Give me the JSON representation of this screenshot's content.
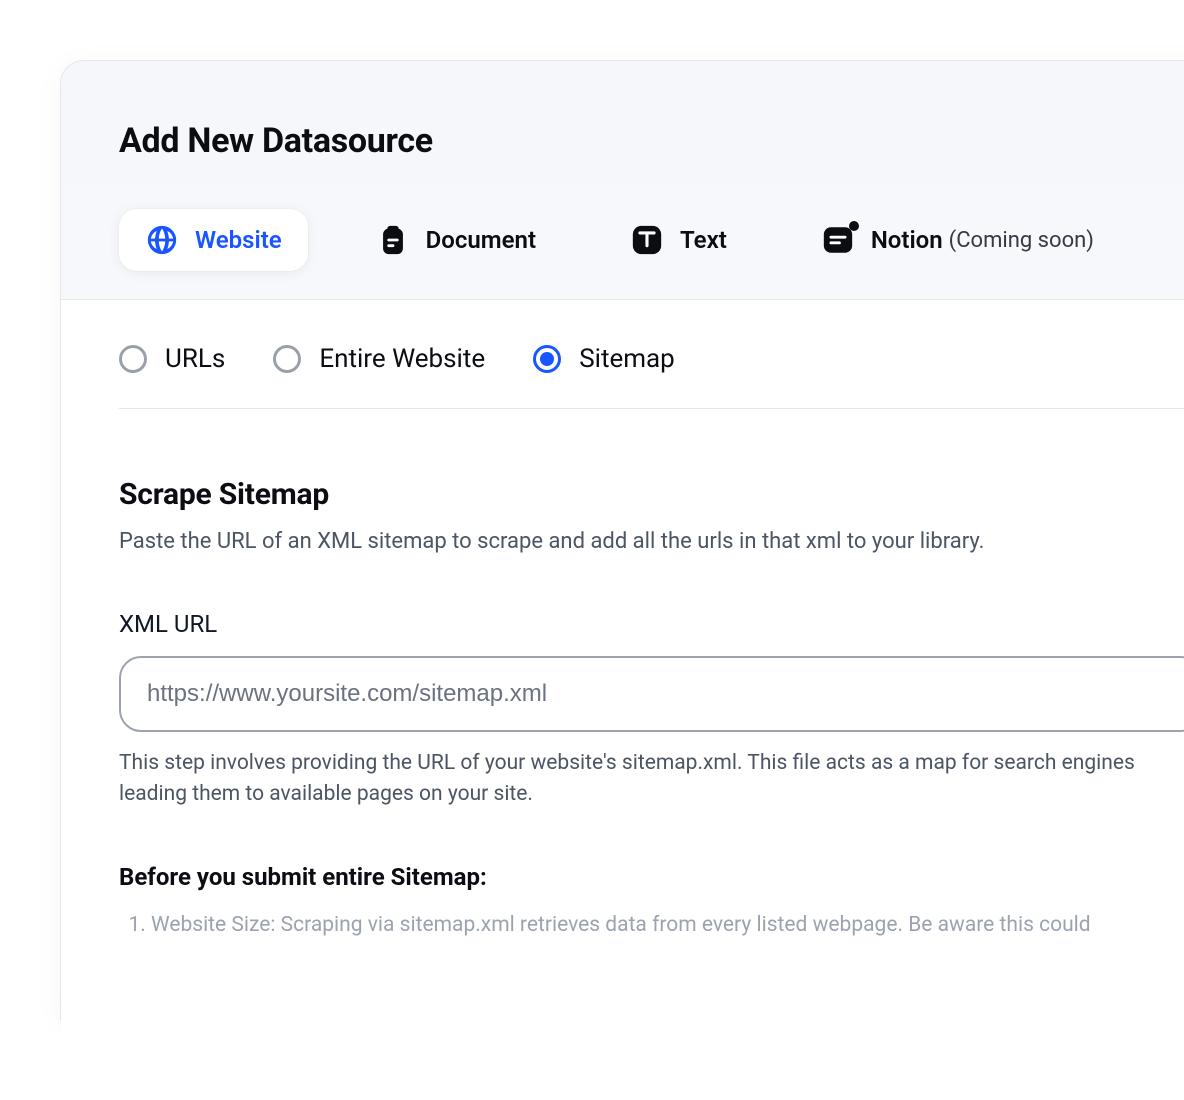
{
  "page": {
    "title": "Add New Datasource"
  },
  "tabs": [
    {
      "label": "Website",
      "active": true
    },
    {
      "label": "Document",
      "active": false
    },
    {
      "label": "Text",
      "active": false
    },
    {
      "label": "Notion",
      "active": false,
      "suffix": "(Coming soon)"
    }
  ],
  "radios": [
    {
      "label": "URLs",
      "selected": false
    },
    {
      "label": "Entire Website",
      "selected": false
    },
    {
      "label": "Sitemap",
      "selected": true
    }
  ],
  "section": {
    "title": "Scrape Sitemap",
    "description": "Paste the URL of an XML sitemap to scrape and add all the urls in that xml to your library."
  },
  "field": {
    "label": "XML URL",
    "placeholder": "https://www.yoursite.com/sitemap.xml",
    "help": "This step involves providing the URL of your website's sitemap.xml. This file acts as a map for search engines leading them to available pages on your site."
  },
  "warning": {
    "title": "Before you submit entire Sitemap:",
    "item1": "Website Size: Scraping via sitemap.xml retrieves data from every listed webpage. Be aware this could"
  }
}
